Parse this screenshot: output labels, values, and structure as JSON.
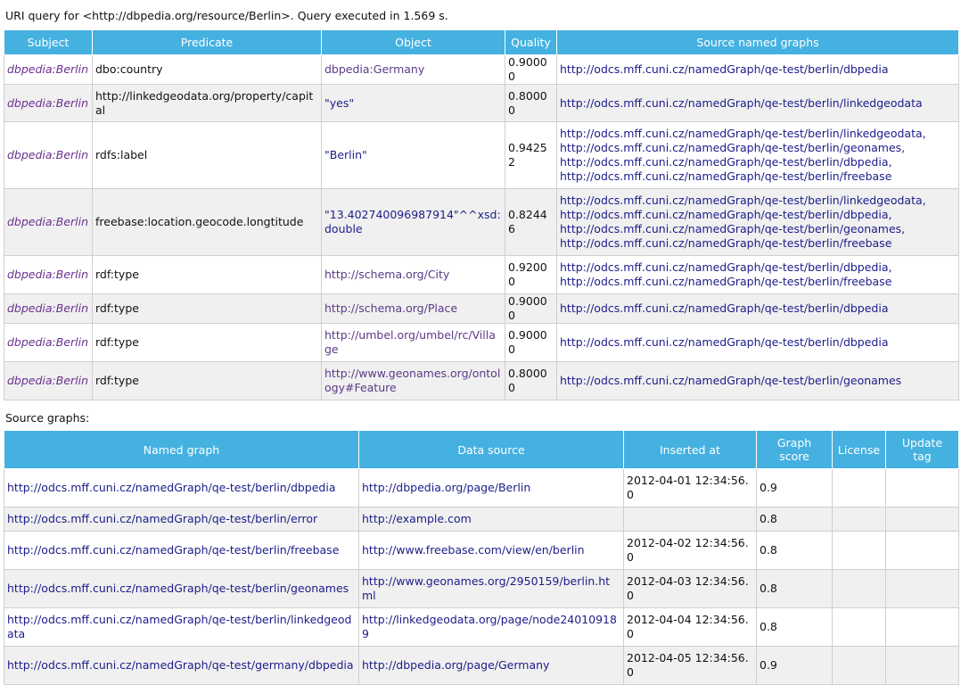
{
  "info": "URI query for <http://dbpedia.org/resource/Berlin>. Query executed in 1.569 s.",
  "quads_table": {
    "headers": [
      "Subject",
      "Predicate",
      "Object",
      "Quality",
      "Source named graphs"
    ],
    "rows": [
      {
        "subject": "dbpedia:Berlin",
        "predicate": "dbo:country",
        "object": "dbpedia:Germany",
        "quality": "0.90000",
        "sources": [
          "http://odcs.mff.cuni.cz/namedGraph/qe-test/berlin/dbpedia"
        ]
      },
      {
        "subject": "dbpedia:Berlin",
        "predicate": "http://linkedgeodata.org/property/capital",
        "object": "\"yes\"",
        "quality": "0.80000",
        "sources": [
          "http://odcs.mff.cuni.cz/namedGraph/qe-test/berlin/linkedgeodata"
        ]
      },
      {
        "subject": "dbpedia:Berlin",
        "predicate": "rdfs:label",
        "object": "\"Berlin\"",
        "quality": "0.94252",
        "sources": [
          "http://odcs.mff.cuni.cz/namedGraph/qe-test/berlin/linkedgeodata,",
          "http://odcs.mff.cuni.cz/namedGraph/qe-test/berlin/geonames,",
          "http://odcs.mff.cuni.cz/namedGraph/qe-test/berlin/dbpedia,",
          "http://odcs.mff.cuni.cz/namedGraph/qe-test/berlin/freebase"
        ]
      },
      {
        "subject": "dbpedia:Berlin",
        "predicate": "freebase:location.geocode.longtitude",
        "object": "\"13.402740096987914\"^^xsd:double",
        "quality": "0.82446",
        "sources": [
          "http://odcs.mff.cuni.cz/namedGraph/qe-test/berlin/linkedgeodata,",
          "http://odcs.mff.cuni.cz/namedGraph/qe-test/berlin/dbpedia,",
          "http://odcs.mff.cuni.cz/namedGraph/qe-test/berlin/geonames,",
          "http://odcs.mff.cuni.cz/namedGraph/qe-test/berlin/freebase"
        ]
      },
      {
        "subject": "dbpedia:Berlin",
        "predicate": "rdf:type",
        "object": "http://schema.org/City",
        "quality": "0.92000",
        "sources": [
          "http://odcs.mff.cuni.cz/namedGraph/qe-test/berlin/dbpedia,",
          "http://odcs.mff.cuni.cz/namedGraph/qe-test/berlin/freebase"
        ]
      },
      {
        "subject": "dbpedia:Berlin",
        "predicate": "rdf:type",
        "object": "http://schema.org/Place",
        "quality": "0.90000",
        "sources": [
          "http://odcs.mff.cuni.cz/namedGraph/qe-test/berlin/dbpedia"
        ]
      },
      {
        "subject": "dbpedia:Berlin",
        "predicate": "rdf:type",
        "object": "http://umbel.org/umbel/rc/Village",
        "quality": "0.90000",
        "sources": [
          "http://odcs.mff.cuni.cz/namedGraph/qe-test/berlin/dbpedia"
        ]
      },
      {
        "subject": "dbpedia:Berlin",
        "predicate": "rdf:type",
        "object": "http://www.geonames.org/ontology#Feature",
        "quality": "0.80000",
        "sources": [
          "http://odcs.mff.cuni.cz/namedGraph/qe-test/berlin/geonames"
        ]
      }
    ]
  },
  "source_graphs_caption": "Source graphs:",
  "graphs_table": {
    "headers": [
      "Named graph",
      "Data source",
      "Inserted at",
      "Graph score",
      "License",
      "Update tag"
    ],
    "rows": [
      {
        "graph": "http://odcs.mff.cuni.cz/namedGraph/qe-test/berlin/dbpedia",
        "source": "http://dbpedia.org/page/Berlin",
        "inserted": "2012-04-01 12:34:56.0",
        "score": "0.9"
      },
      {
        "graph": "http://odcs.mff.cuni.cz/namedGraph/qe-test/berlin/error",
        "source": "http://example.com",
        "inserted": "",
        "score": "0.8"
      },
      {
        "graph": "http://odcs.mff.cuni.cz/namedGraph/qe-test/berlin/freebase",
        "source": "http://www.freebase.com/view/en/berlin",
        "inserted": "2012-04-02 12:34:56.0",
        "score": "0.8"
      },
      {
        "graph": "http://odcs.mff.cuni.cz/namedGraph/qe-test/berlin/geonames",
        "source": "http://www.geonames.org/2950159/berlin.html",
        "inserted": "2012-04-03 12:34:56.0",
        "score": "0.8"
      },
      {
        "graph": "http://odcs.mff.cuni.cz/namedGraph/qe-test/berlin/linkedgeodata",
        "source": "http://linkedgeodata.org/page/node240109189",
        "inserted": "2012-04-04 12:34:56.0",
        "score": "0.8"
      },
      {
        "graph": "http://odcs.mff.cuni.cz/namedGraph/qe-test/germany/dbpedia",
        "source": "http://dbpedia.org/page/Germany",
        "inserted": "2012-04-05 12:34:56.0",
        "score": "0.9"
      }
    ]
  }
}
